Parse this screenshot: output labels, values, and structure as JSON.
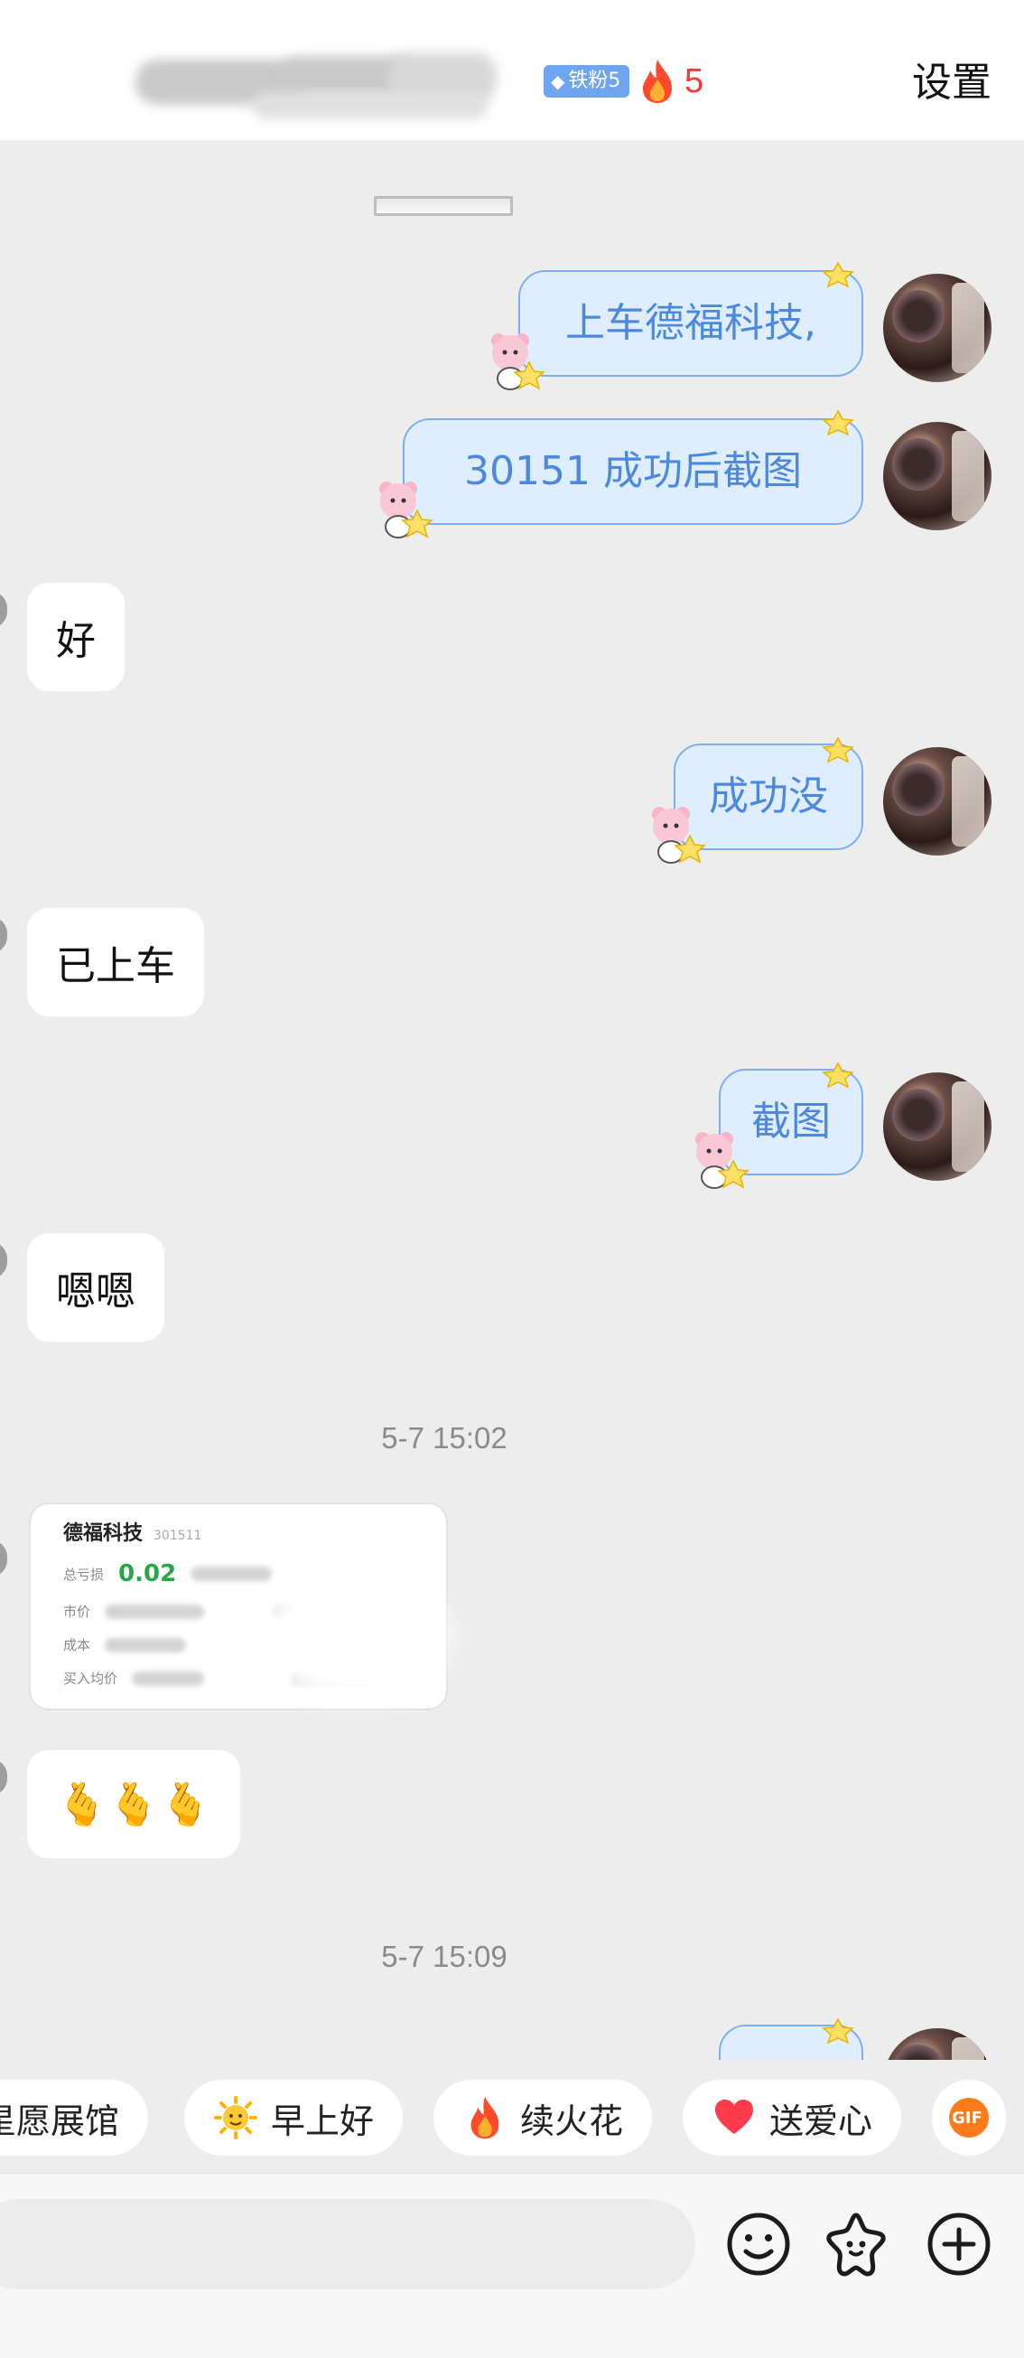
{
  "header": {
    "contact_name": "",
    "fan_badge": "铁粉5",
    "fire_count": "5",
    "settings_label": "设置"
  },
  "messages": {
    "m1": "上车德福科技,",
    "m2": "30151   成功后截图",
    "m3": "好",
    "m4": "成功没",
    "m5": "已上车",
    "m6": "截图",
    "m7": "嗯嗯",
    "time1": "5-7 15:02",
    "m9": "🫰🫰🫰",
    "time2": "5-7 15:09"
  },
  "image_card": {
    "title": "德福科技",
    "code": "301511",
    "row1_label": "总亏损",
    "row1_value": "0.02",
    "row2_label": "市价",
    "row3_label": "成本",
    "row4_label": "买入均价"
  },
  "quick_actions": [
    {
      "label": "星愿展馆"
    },
    {
      "label": "早上好"
    },
    {
      "label": "续火花"
    },
    {
      "label": "送爱心"
    },
    {
      "label": "GIF"
    }
  ],
  "input": {
    "placeholder": ""
  },
  "colors": {
    "outgoing_bubble_bg": "#dfeeff",
    "outgoing_bubble_text": "#4c88de",
    "fire_count": "#f03c3c",
    "fan_badge": "#6ea5ee"
  }
}
